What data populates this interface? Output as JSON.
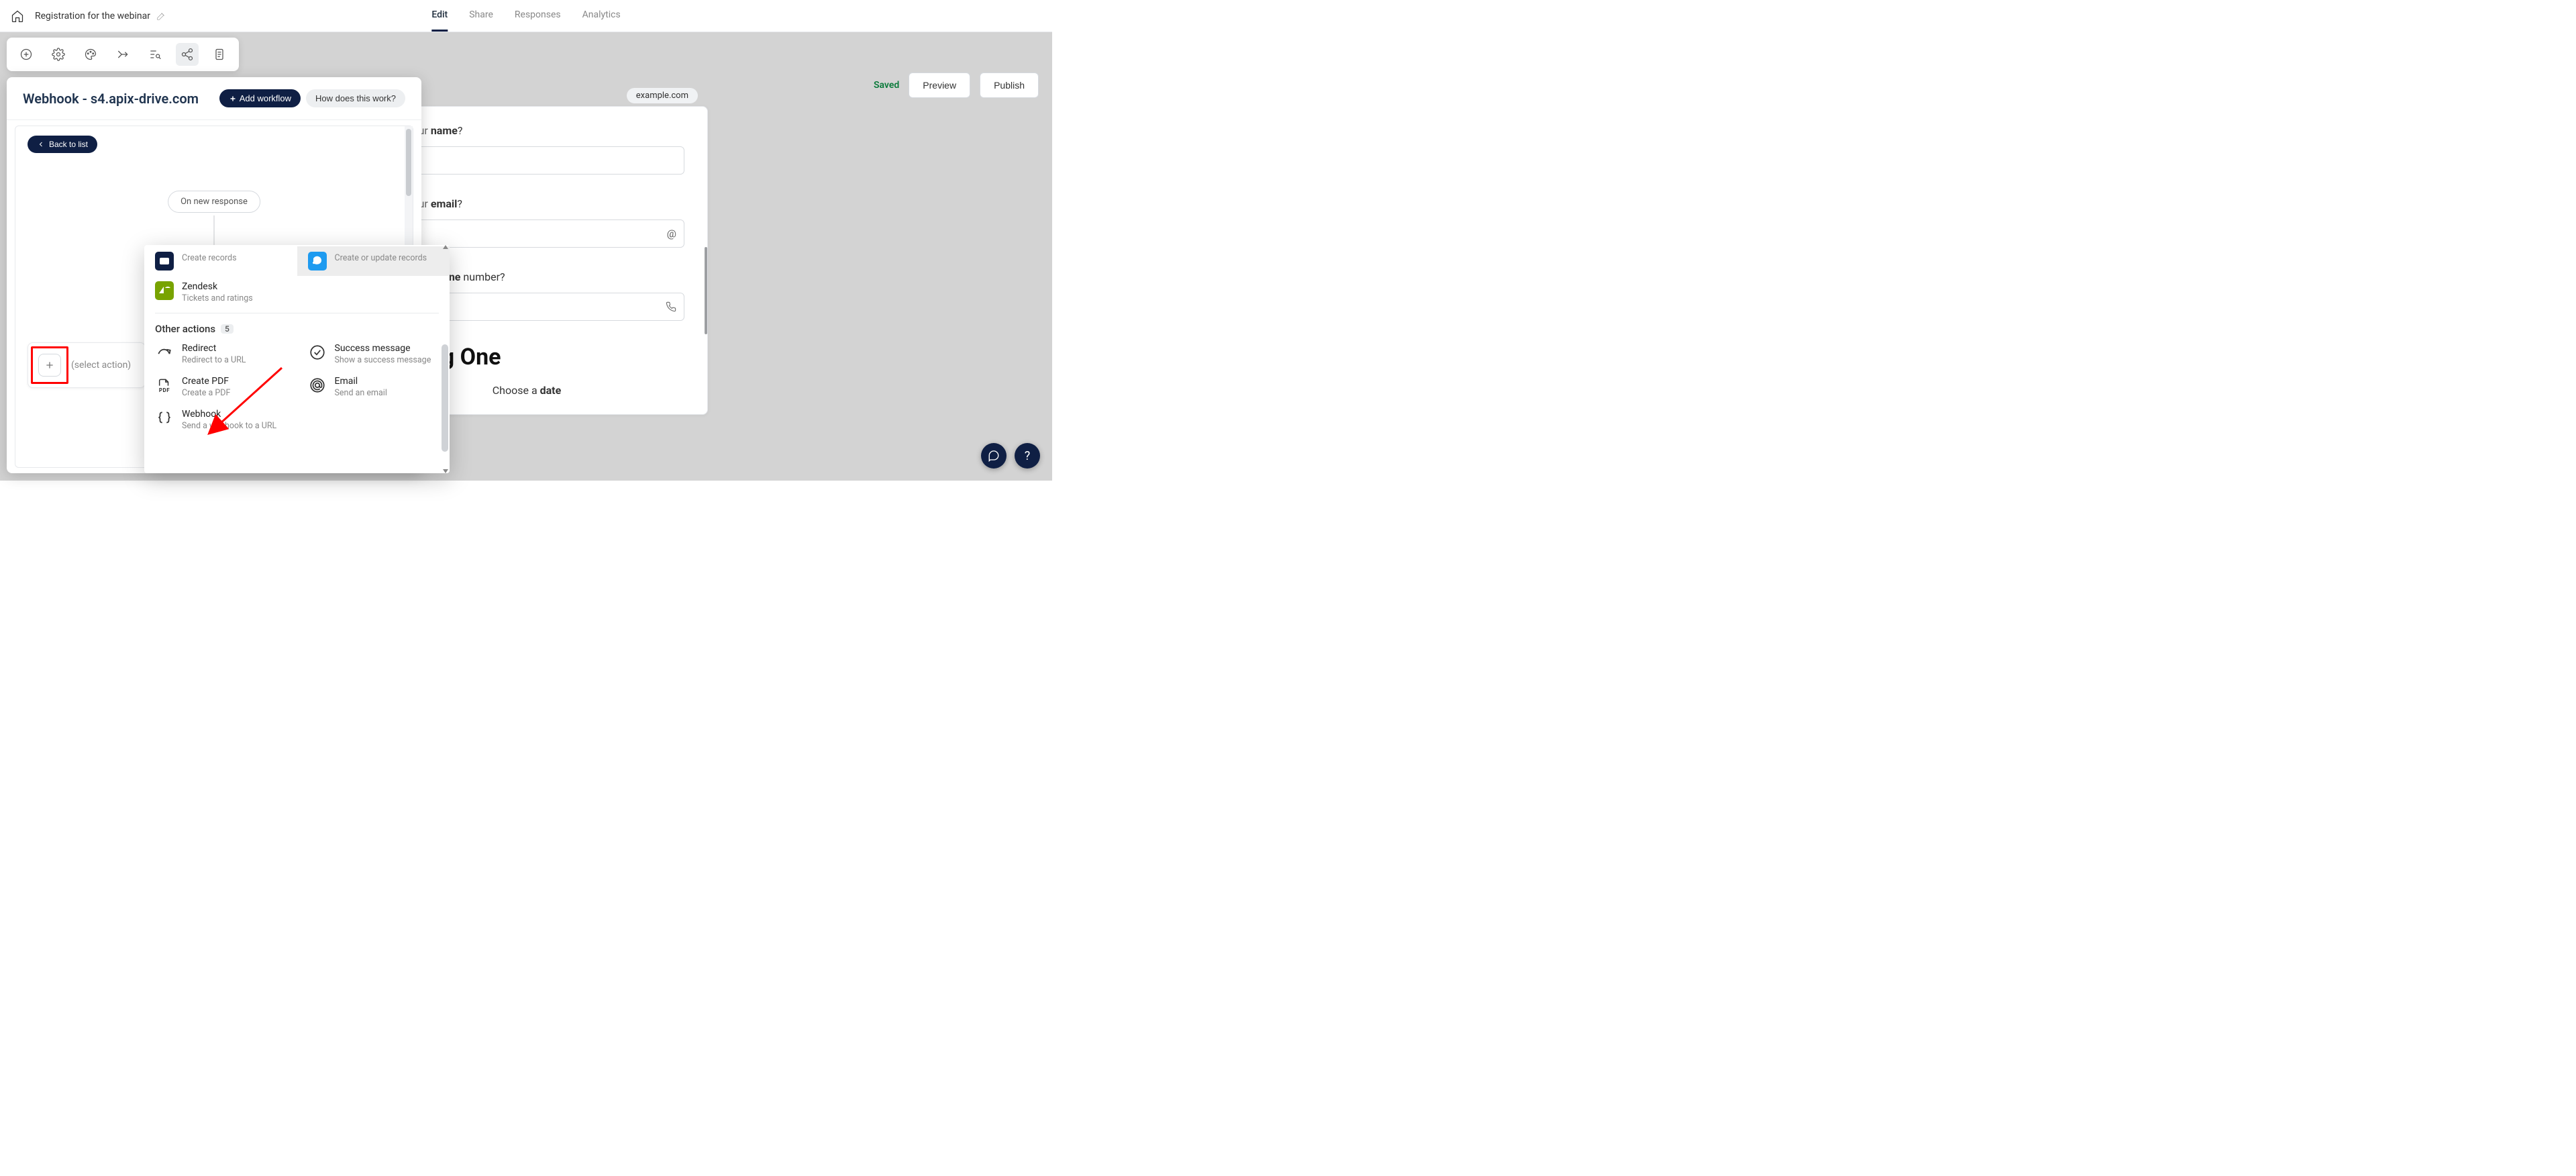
{
  "header": {
    "title": "Registration for the webinar",
    "tabs": [
      "Edit",
      "Share",
      "Responses",
      "Analytics"
    ],
    "active_tab": "Edit"
  },
  "right": {
    "saved": "Saved",
    "preview": "Preview",
    "publish": "Publish"
  },
  "panel": {
    "title": "Webhook - s4.apix-drive.com",
    "add_workflow": "Add workflow",
    "how": "How does this work?",
    "back": "Back to list",
    "trigger": "On new response",
    "select_action": "(select action)"
  },
  "dropdown": {
    "top_row": {
      "left": {
        "title": "",
        "sub": "Create records"
      },
      "right": {
        "title": "",
        "sub": "Create or update records"
      }
    },
    "zendesk": {
      "title": "Zendesk",
      "sub": "Tickets and ratings"
    },
    "section": {
      "label": "Other actions",
      "count": "5"
    },
    "actions": {
      "redirect": {
        "title": "Redirect",
        "sub": "Redirect to a URL"
      },
      "success": {
        "title": "Success message",
        "sub": "Show a success message"
      },
      "createpdf": {
        "title": "Create PDF",
        "sub": "Create a PDF"
      },
      "email": {
        "title": "Email",
        "sub": "Send an email"
      },
      "webhook": {
        "title": "Webhook",
        "sub": "Send a webhook to a URL"
      }
    }
  },
  "form": {
    "chip": "example.com",
    "q1_prefix": "What is your ",
    "q1_bold": "name",
    "q1_suffix": "?",
    "q2_prefix": "What is your ",
    "q2_bold": "email",
    "q2_suffix": "?",
    "q3_prefix": "What is your ",
    "q3_bold": "phone",
    "q3_suffix": " number?",
    "heading": "Heading One",
    "choose_prefix": "Choose a ",
    "choose_bold": "date"
  },
  "toolbar": {
    "icons": [
      "add",
      "settings",
      "palette",
      "branch",
      "search-list",
      "share-nodes",
      "page"
    ]
  },
  "fab": {
    "help": "?"
  }
}
